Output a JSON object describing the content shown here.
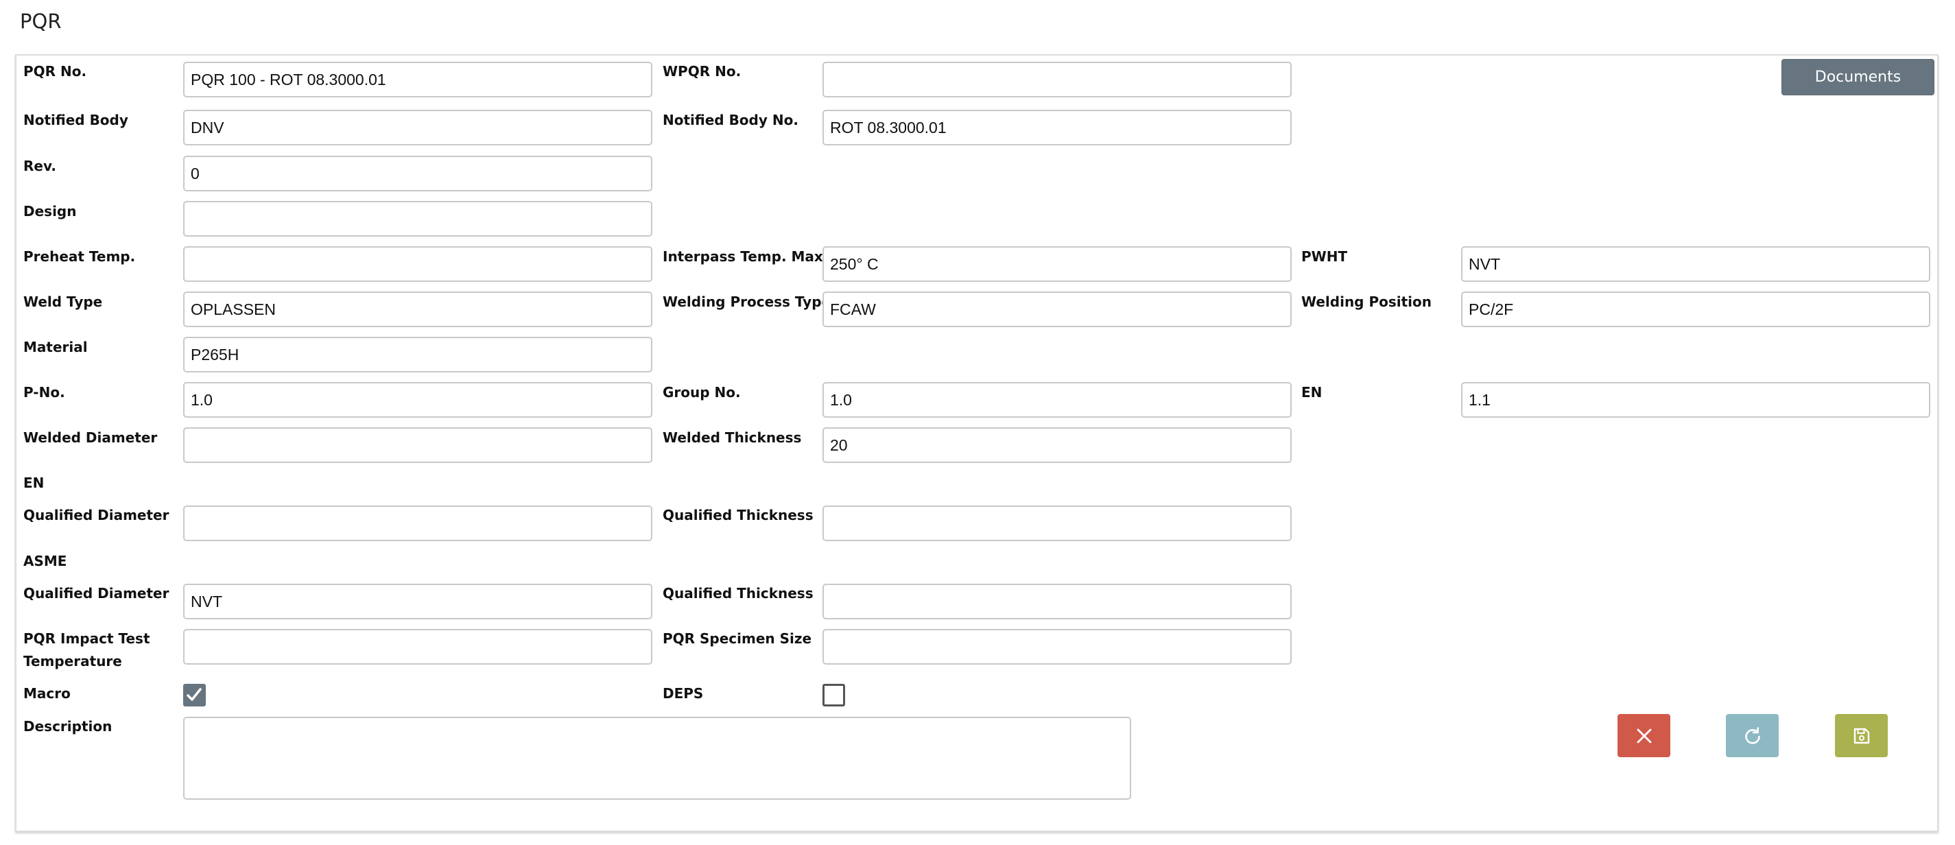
{
  "page": {
    "title": "PQR"
  },
  "toolbar": {
    "documents_label": "Documents"
  },
  "form": {
    "pqr_no": {
      "label": "PQR No.",
      "value": "PQR 100 - ROT 08.3000.01"
    },
    "wpqr_no": {
      "label": "WPQR No.",
      "value": ""
    },
    "notified_body": {
      "label": "Notified Body",
      "value": "DNV"
    },
    "notified_body_no": {
      "label": "Notified Body No.",
      "value": "ROT 08.3000.01"
    },
    "rev": {
      "label": "Rev.",
      "value": "0"
    },
    "design": {
      "label": "Design",
      "value": ""
    },
    "preheat_temp": {
      "label": "Preheat Temp.",
      "value": ""
    },
    "interpass_temp_max": {
      "label": "Interpass Temp. Max.",
      "value": "250° C"
    },
    "pwht": {
      "label": "PWHT",
      "value": "NVT"
    },
    "weld_type": {
      "label": "Weld Type",
      "value": "OPLASSEN"
    },
    "welding_process_type": {
      "label": "Welding Process Type",
      "value": "FCAW"
    },
    "welding_position": {
      "label": "Welding Position",
      "value": "PC/2F"
    },
    "material": {
      "label": "Material",
      "value": "P265H"
    },
    "p_no": {
      "label": "P-No.",
      "value": "1.0"
    },
    "group_no": {
      "label": "Group No.",
      "value": "1.0"
    },
    "en_value": {
      "label": "EN",
      "value": "1.1"
    },
    "welded_diameter": {
      "label": "Welded Diameter",
      "value": ""
    },
    "welded_thickness": {
      "label": "Welded Thickness",
      "value": "20"
    },
    "en_section": {
      "heading": "EN"
    },
    "en_qualified_diameter": {
      "label": "Qualified Diameter",
      "value": ""
    },
    "en_qualified_thickness": {
      "label": "Qualified Thickness",
      "value": ""
    },
    "asme_section": {
      "heading": "ASME"
    },
    "asme_qualified_diameter": {
      "label": "Qualified Diameter",
      "value": "NVT"
    },
    "asme_qualified_thickness": {
      "label": "Qualified Thickness",
      "value": ""
    },
    "pqr_impact_test_temperature": {
      "label_line1": "PQR Impact Test",
      "label_line2": "Temperature",
      "value": ""
    },
    "pqr_specimen_size": {
      "label": "PQR Specimen Size",
      "value": ""
    },
    "macro": {
      "label": "Macro",
      "checked": true
    },
    "deps": {
      "label": "DEPS",
      "checked": false
    },
    "description": {
      "label": "Description",
      "value": ""
    }
  },
  "actions": {
    "cancel_icon": "close-icon",
    "refresh_icon": "refresh-icon",
    "save_icon": "floppy-disk-icon"
  },
  "colors": {
    "documents_button": "#66757f",
    "cancel_button": "#d1594a",
    "refresh_button": "#8db9c2",
    "save_button": "#a9b24e"
  }
}
